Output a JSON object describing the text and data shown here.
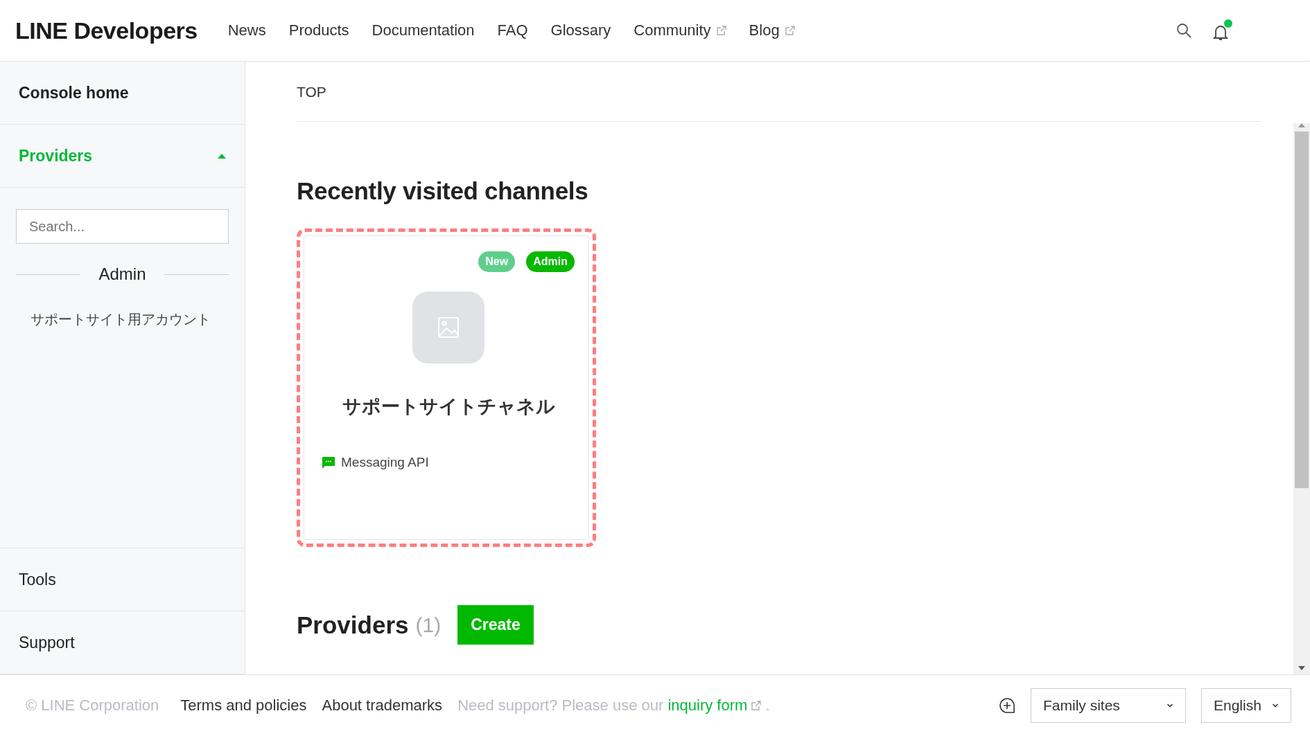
{
  "header": {
    "logo": "LINE Developers",
    "nav": [
      {
        "label": "News",
        "external": false
      },
      {
        "label": "Products",
        "external": false
      },
      {
        "label": "Documentation",
        "external": false
      },
      {
        "label": "FAQ",
        "external": false
      },
      {
        "label": "Glossary",
        "external": false
      },
      {
        "label": "Community",
        "external": true
      },
      {
        "label": "Blog",
        "external": true
      }
    ],
    "notification_unread": true
  },
  "sidebar": {
    "console_home": "Console home",
    "providers": {
      "label": "Providers",
      "expanded": true
    },
    "search": {
      "placeholder": "Search..."
    },
    "group": "Admin",
    "items": [
      "サポートサイト用アカウント"
    ],
    "bottom": [
      "Tools",
      "Support"
    ]
  },
  "main": {
    "breadcrumb": "TOP",
    "recent_heading": "Recently visited channels",
    "channels": [
      {
        "name": "サポートサイトチャネル",
        "type": "Messaging API",
        "highlighted": true,
        "badges": [
          {
            "label": "New",
            "kind": "new"
          },
          {
            "label": "Admin",
            "kind": "admin"
          }
        ]
      }
    ],
    "providers_heading": "Providers",
    "providers_count": "(1)",
    "create_button": "Create"
  },
  "footer": {
    "copyright": "© LINE Corporation",
    "links": [
      "Terms and policies",
      "About trademarks"
    ],
    "support_text": "Need support? Please use our ",
    "support_link": "inquiry form",
    "support_end": ".",
    "family_sites": "Family sites",
    "language": "English"
  }
}
